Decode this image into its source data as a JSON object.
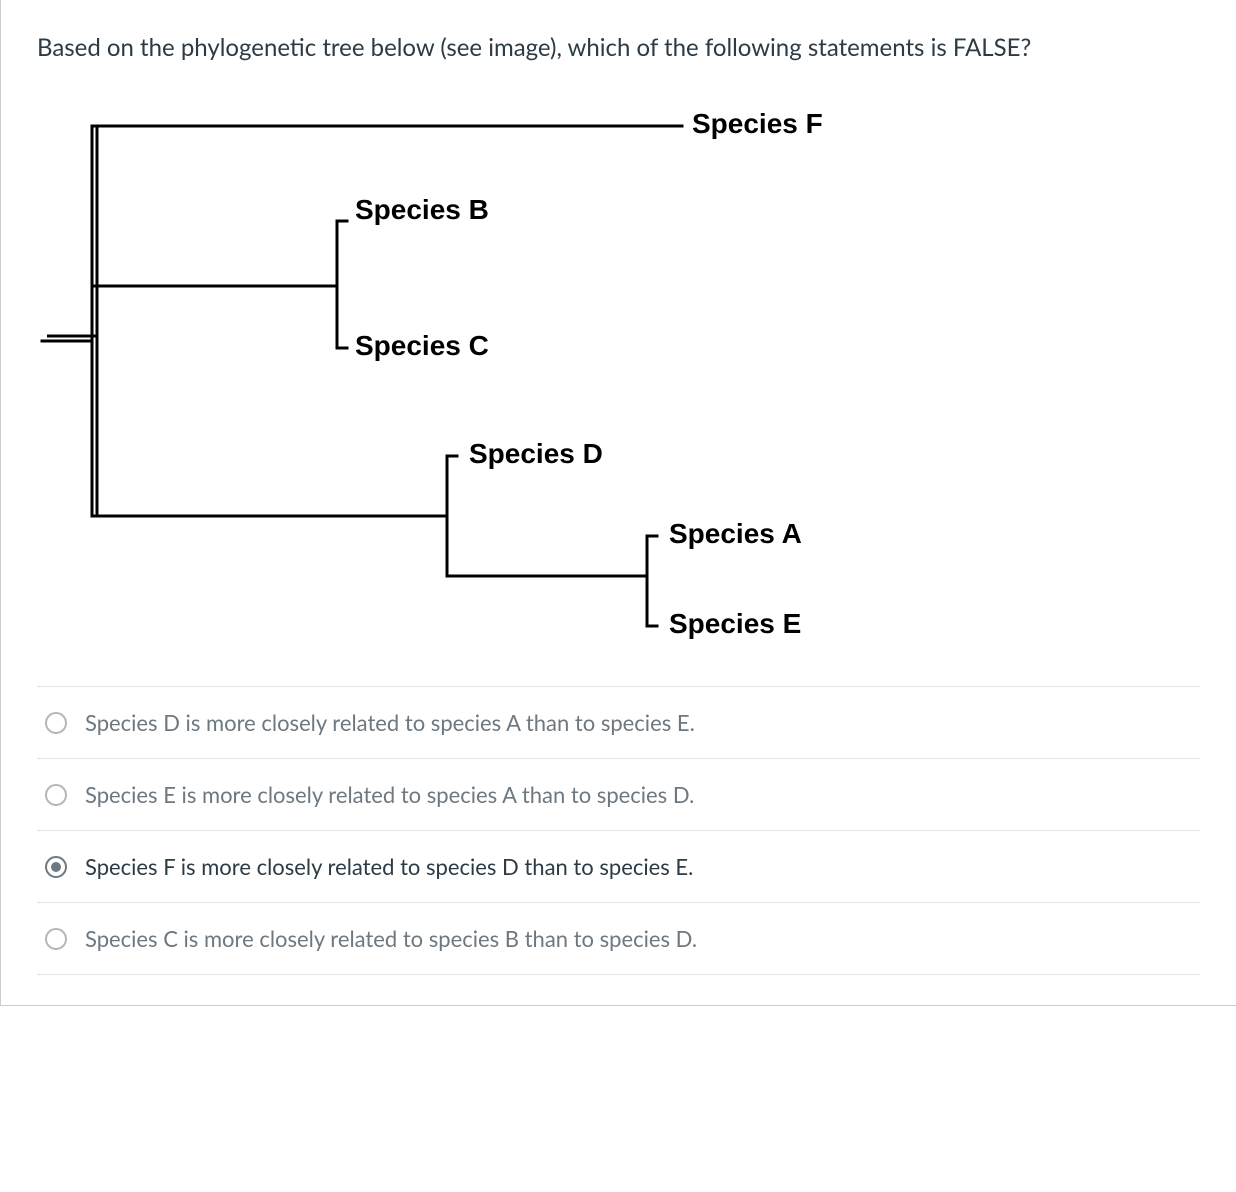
{
  "question": "Based on the phylogenetic tree below (see image), which of the following statements is FALSE?",
  "species": {
    "F": "Species F",
    "B": "Species B",
    "C": "Species C",
    "D": "Species D",
    "A": "Species A",
    "E": "Species E"
  },
  "answers": [
    {
      "label": "Species D is more closely related to species A than to species E.",
      "selected": false
    },
    {
      "label": "Species E is more closely related to species A than to species D.",
      "selected": false
    },
    {
      "label": "Species F is more closely related to species D than to species E.",
      "selected": true
    },
    {
      "label": "Species C is more closely related to species B than to species D.",
      "selected": false
    }
  ],
  "chart_data": {
    "type": "phylogenetic_tree",
    "newick": "(F,((B,C),(D,(A,E))));",
    "notes": "Root splits into F vs rest. Rest splits into (B,C) clade and (D,(A,E)) clade."
  }
}
